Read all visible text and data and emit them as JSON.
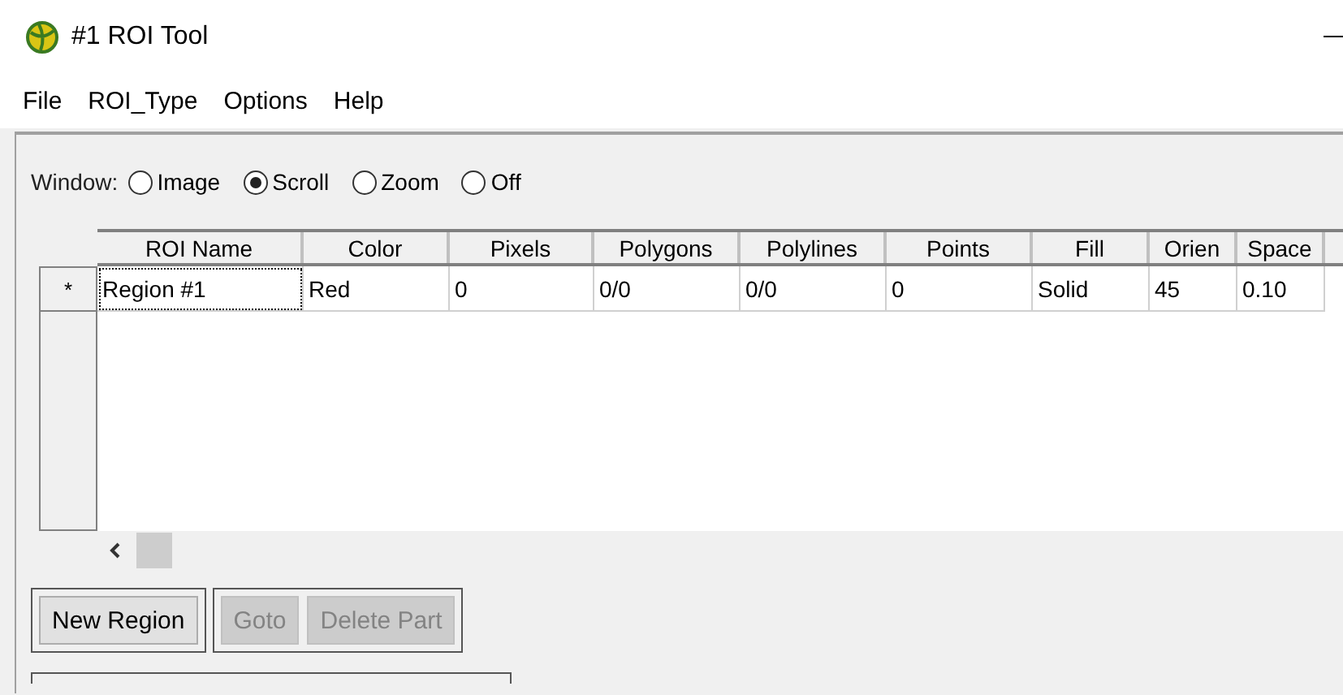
{
  "window": {
    "title": "#1 ROI Tool"
  },
  "menu": [
    "File",
    "ROI_Type",
    "Options",
    "Help"
  ],
  "window_mode": {
    "label": "Window:",
    "options": [
      {
        "label": "Image",
        "selected": false
      },
      {
        "label": "Scroll",
        "selected": true
      },
      {
        "label": "Zoom",
        "selected": false
      },
      {
        "label": "Off",
        "selected": false
      }
    ]
  },
  "table": {
    "columns": [
      "ROI Name",
      "Color",
      "Pixels",
      "Polygons",
      "Polylines",
      "Points",
      "Fill",
      "Orien",
      "Space"
    ],
    "rows": [
      {
        "marker": "*",
        "cells": [
          "Region #1",
          "Red",
          "0",
          "0/0",
          "0/0",
          "0",
          "Solid",
          "45",
          "0.10"
        ]
      }
    ]
  },
  "button_groups": [
    [
      {
        "label": "New Region",
        "disabled": false
      }
    ],
    [
      {
        "label": "Goto",
        "disabled": true
      },
      {
        "label": "Delete Part",
        "disabled": true
      }
    ]
  ]
}
